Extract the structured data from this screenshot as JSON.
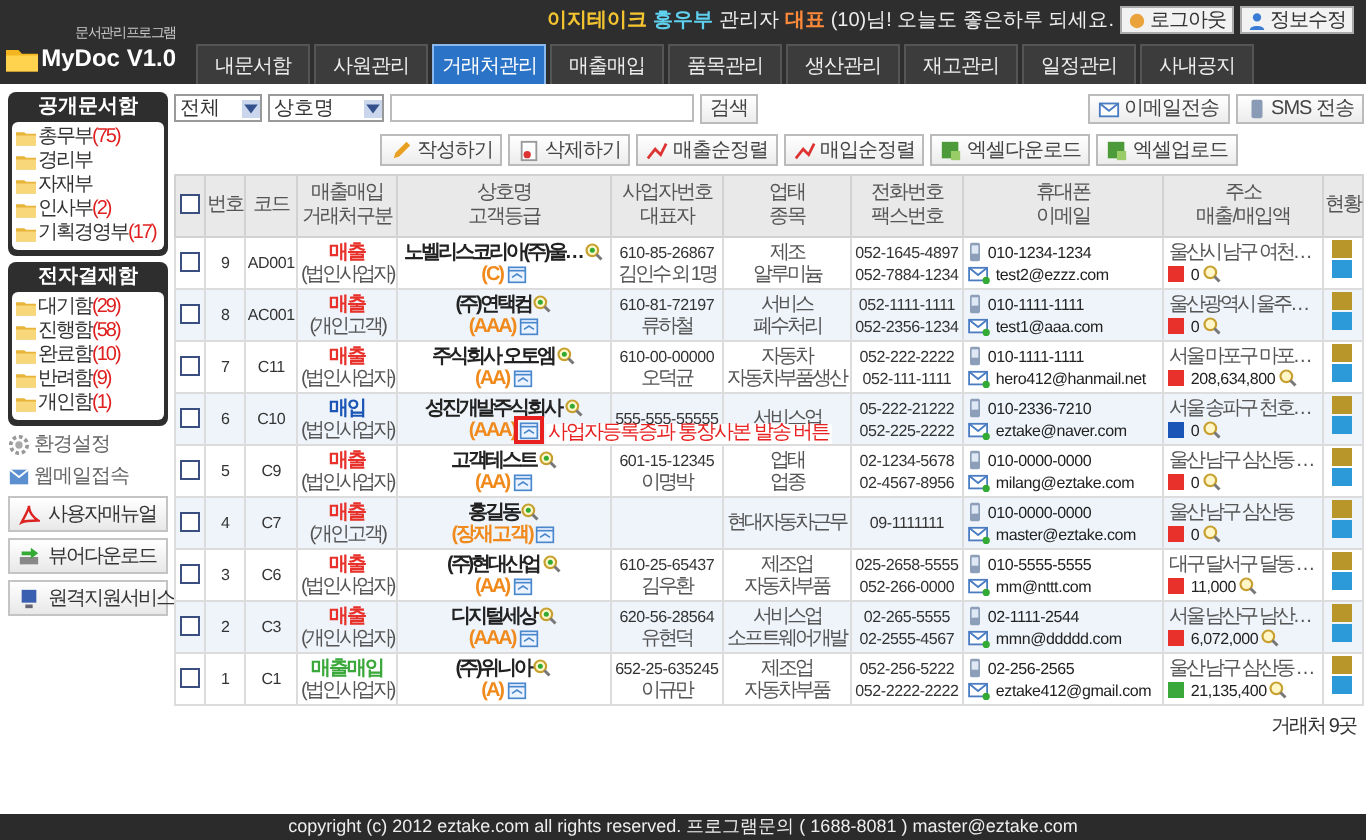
{
  "header": {
    "logo_small": "문서관리프로그램",
    "logo": "MyDoc V1.0",
    "greeting": [
      {
        "kind": "company",
        "text": "이지테이크"
      },
      {
        "kind": "name",
        "text": "홍우부"
      },
      {
        "kind": "plain",
        "text": "관리자"
      },
      {
        "kind": "role",
        "text": "대표"
      },
      {
        "kind": "plain",
        "text": "(10)님! 오늘도 좋은하루 되세요."
      }
    ],
    "buttons": [
      {
        "label": "로그아웃",
        "kind": "logout"
      },
      {
        "label": "정보수정",
        "kind": "profile"
      }
    ]
  },
  "tabs": [
    {
      "label": "내문서함",
      "selected": false
    },
    {
      "label": "사원관리",
      "selected": false
    },
    {
      "label": "거래처관리",
      "selected": true
    },
    {
      "label": "매출매입",
      "selected": false
    },
    {
      "label": "품목관리",
      "selected": false
    },
    {
      "label": "생산관리",
      "selected": false
    },
    {
      "label": "재고관리",
      "selected": false
    },
    {
      "label": "일정관리",
      "selected": false
    },
    {
      "label": "사내공지",
      "selected": false
    }
  ],
  "sidebar": {
    "boxes": [
      {
        "title": "공개문서함",
        "items": [
          {
            "label": "총무부",
            "count": "(75)"
          },
          {
            "label": "경리부"
          },
          {
            "label": "자재부"
          },
          {
            "label": "인사부",
            "count": "(2)"
          },
          {
            "label": "기획경영부",
            "count": "(17)"
          }
        ]
      },
      {
        "title": "전자결재함",
        "items": [
          {
            "label": "대기함",
            "count": "(29)"
          },
          {
            "label": "진행함",
            "count": "(58)"
          },
          {
            "label": "완료함",
            "count": "(10)"
          },
          {
            "label": "반려함",
            "count": "(9)"
          },
          {
            "label": "개인함",
            "count": "(1)"
          }
        ]
      }
    ],
    "links": [
      {
        "label": "환경설정",
        "kind": "settings"
      },
      {
        "label": "웹메일접속",
        "kind": "mail"
      }
    ],
    "buttons": [
      {
        "label": "사용자매뉴얼",
        "kind": "pdf"
      },
      {
        "label": "뷰어다운로드",
        "kind": "download"
      },
      {
        "label": "원격지원서비스",
        "kind": "remote"
      }
    ]
  },
  "toolbar": {
    "filter": "전체",
    "field": "상호명",
    "search_button": "검색",
    "right_buttons": [
      {
        "label": "이메일전송",
        "kind": "mail"
      },
      {
        "label": "SMS 전송",
        "kind": "sms"
      }
    ]
  },
  "actions": [
    {
      "label": "작성하기",
      "kind": "write"
    },
    {
      "label": "삭제하기",
      "kind": "delete"
    },
    {
      "label": "매출순정렬",
      "kind": "sort"
    },
    {
      "label": "매입순정렬",
      "kind": "sort"
    },
    {
      "label": "엑셀다운로드",
      "kind": "excel"
    },
    {
      "label": "엑셀업로드",
      "kind": "excel"
    }
  ],
  "table": {
    "select_all_checked": false,
    "columns": [
      [
        "번호"
      ],
      [
        "코드"
      ],
      [
        "매출매입",
        "거래처구분"
      ],
      [
        "상호명",
        "고객등급"
      ],
      [
        "사업자번호",
        "대표자"
      ],
      [
        "업태",
        "종목"
      ],
      [
        "전화번호",
        "팩스번호"
      ],
      [
        "휴대폰",
        "이메일"
      ],
      [
        "주소",
        "매출/매입액"
      ],
      [
        "현황"
      ]
    ],
    "rows": [
      {
        "checked": false,
        "no": "9",
        "code": "AD001",
        "trade": "매출",
        "color": "#e8312a",
        "client_type": "(법인사업자)",
        "name": "노벨리스코리아(주)울…",
        "grade": "(C)",
        "biz_no": "610-85-26867",
        "ceo": "김인수 외 1명",
        "industry": "제조",
        "item": "알루미늄",
        "phone": "052-1645-4897",
        "fax": "052-7884-1234",
        "mobile": "010-1234-1234",
        "email": "test2@ezzz.com",
        "address": "울산시 남구 여천…",
        "amount": "0"
      },
      {
        "checked": false,
        "no": "8",
        "code": "AC001",
        "trade": "매출",
        "color": "#e8312a",
        "client_type": "(개인고객)",
        "name": "(주)연택컴",
        "grade": "(AAA)",
        "biz_no": "610-81-72197",
        "ceo": "류하철",
        "industry": "서비스",
        "item": "폐수처리",
        "phone": "052-1111-1111",
        "fax": "052-2356-1234",
        "mobile": "010-1111-1111",
        "email": "test1@aaa.com",
        "address": "울산광역시 울주…",
        "amount": "0"
      },
      {
        "checked": false,
        "no": "7",
        "code": "C11",
        "trade": "매출",
        "color": "#e8312a",
        "client_type": "(법인사업자)",
        "name": "주식회사 오토엠",
        "grade": "(AA)",
        "biz_no": "610-00-00000",
        "ceo": "오덕균",
        "industry": "자동차",
        "item": "자동차부품생산",
        "phone": "052-222-2222",
        "fax": "052-111-1111",
        "mobile": "010-1111-1111",
        "email": "hero412@hanmail.net",
        "address": "서울 마포구 마포…",
        "amount": "208,634,800"
      },
      {
        "checked": false,
        "no": "6",
        "code": "C10",
        "trade": "매입",
        "color": "#1b55b5",
        "client_type": "(법인사업자)",
        "name": "성진개발주식회사",
        "grade": "(AAA)",
        "biz_no": "555-555-55555",
        "industry": "서비스업",
        "phone": "05-222-21222",
        "fax": "052-225-2222",
        "mobile": "010-2336-7210",
        "email": "eztake@naver.com",
        "address": "서울 송파구 천호…",
        "amount": "0",
        "callout": "사업자등록증과 통장사본 발송 버튼"
      },
      {
        "checked": false,
        "no": "5",
        "code": "C9",
        "trade": "매출",
        "color": "#e8312a",
        "client_type": "(법인사업자)",
        "name": "고객테스트",
        "grade": "(AA)",
        "biz_no": "601-15-12345",
        "ceo": "이명박",
        "industry": "업태",
        "item": "업종",
        "phone": "02-1234-5678",
        "fax": "02-4567-8956",
        "mobile": "010-0000-0000",
        "email": "milang@eztake.com",
        "address": "울산 남구 삼산동 …",
        "amount": "0"
      },
      {
        "checked": false,
        "no": "4",
        "code": "C7",
        "trade": "매출",
        "color": "#e8312a",
        "client_type": "(개인고객)",
        "name": "홍길동",
        "grade": "(장재고객)",
        "item": "현대자동차근무",
        "fax": "09-1111111",
        "mobile": "010-0000-0000",
        "email": "master@eztake.com",
        "address": "울산 남구 삼산동",
        "amount": "0"
      },
      {
        "checked": false,
        "no": "3",
        "code": "C6",
        "trade": "매출",
        "color": "#e8312a",
        "client_type": "(법인사업자)",
        "name": "(주)현대산업",
        "grade": "(AA)",
        "biz_no": "610-25-65437",
        "ceo": "김우환",
        "industry": "제조업",
        "item": "자동차부품",
        "phone": "025-2658-5555",
        "fax": "052-266-0000",
        "mobile": "010-5555-5555",
        "email": "mm@nttt.com",
        "address": "대구 달서구 달동 …",
        "amount": "11,000"
      },
      {
        "checked": false,
        "no": "2",
        "code": "C3",
        "trade": "매출",
        "color": "#e8312a",
        "client_type": "(개인사업자)",
        "name": "디지털세상",
        "grade": "(AAA)",
        "biz_no": "620-56-28564",
        "ceo": "유현덕",
        "industry": "서비스업",
        "item": "소프트웨어개발",
        "phone": "02-265-5555",
        "fax": "02-2555-4567",
        "mobile": "02-1111-2544",
        "email": "mmn@ddddd.com",
        "address": "서울 남산구 남산…",
        "amount": "6,072,000"
      },
      {
        "checked": false,
        "no": "1",
        "code": "C1",
        "trade": "매출매입",
        "color": "#3aa83a",
        "client_type": "(법인사업자)",
        "name": "(주)위니아",
        "grade": "(A)",
        "biz_no": "652-25-635245",
        "ceo": "이규만",
        "industry": "제조업",
        "item": "자동차부품",
        "phone": "052-256-5222",
        "fax": "052-2222-2222",
        "mobile": "02-256-2565",
        "email": "eztake412@gmail.com",
        "address": "울산 남구 삼산동 …",
        "amount": "21,135,400"
      }
    ],
    "total": "거래처 9곳"
  },
  "footer": "copyright (c) 2012 eztake.com all rights reserved. 프로그램문의 ( 1688-8081 ) master@eztake.com"
}
